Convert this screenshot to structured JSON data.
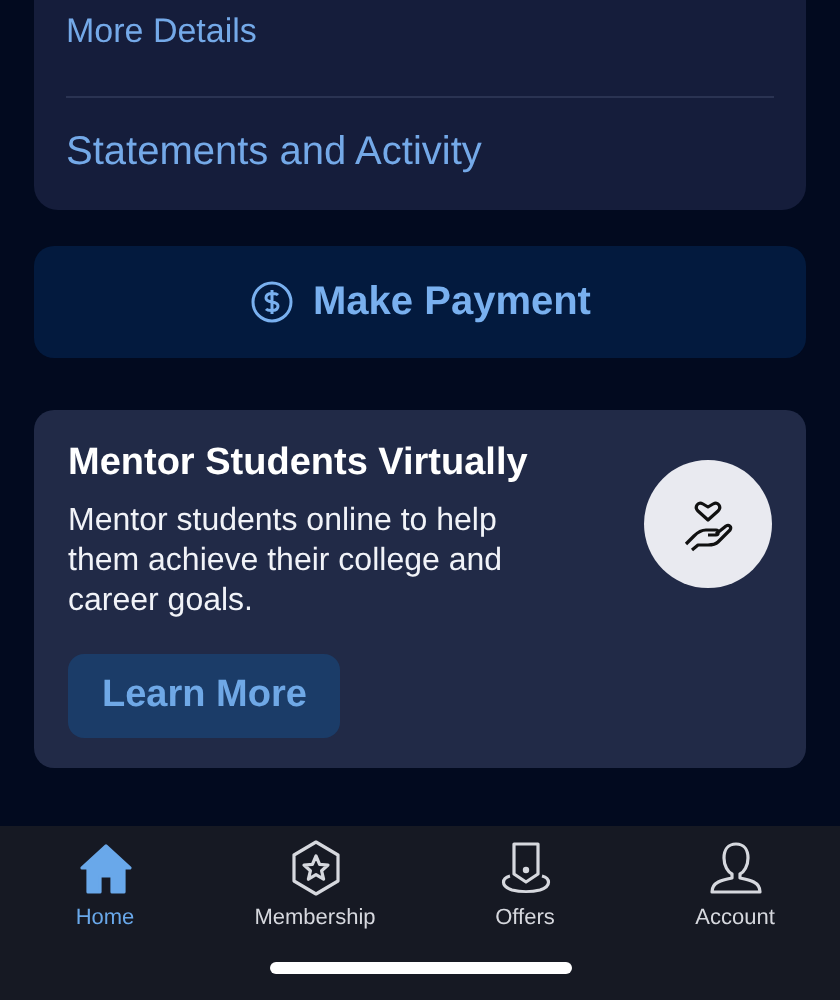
{
  "account_links": [
    "More Details",
    "Statements and Activity"
  ],
  "payment_button": {
    "label": "Make Payment"
  },
  "promo_card": {
    "title": "Mentor Students Virtually",
    "body": "Mentor students online to help them achieve their college and career goals.",
    "button": "Learn More"
  },
  "tab_bar": [
    {
      "label": "Home",
      "kind": "home",
      "selected": true
    },
    {
      "label": "Membership",
      "kind": "membership",
      "selected": false
    },
    {
      "label": "Offers",
      "kind": "offers",
      "selected": false
    },
    {
      "label": "Account",
      "kind": "account",
      "selected": false
    }
  ]
}
